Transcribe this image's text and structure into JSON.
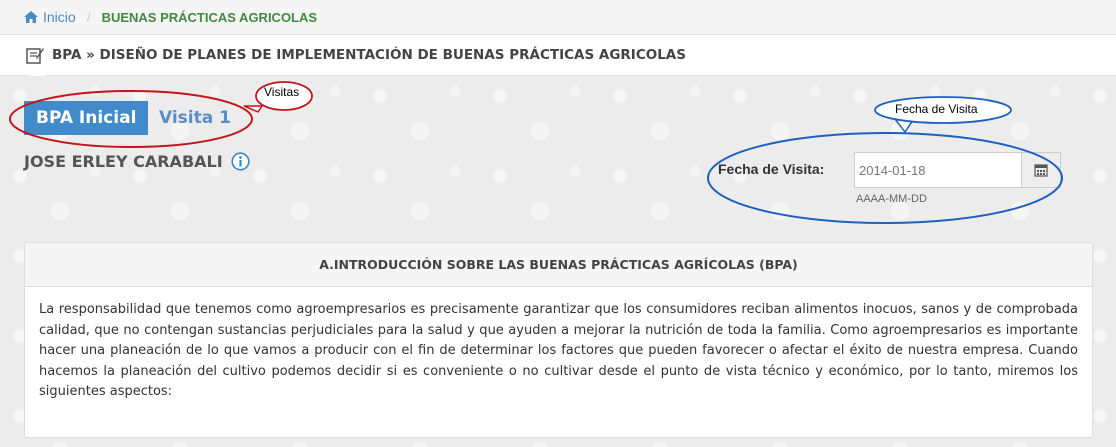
{
  "breadcrumb": {
    "home_label": "Inicio",
    "separator": "/",
    "current": "BUENAS PRÁCTICAS AGRICOLAS"
  },
  "header": {
    "title": "BPA » DISEÑO DE PLANES DE IMPLEMENTACIÓN DE BUENAS PRÁCTICAS AGRICOLAS"
  },
  "tabs": [
    {
      "label": "BPA Inicial",
      "active": true
    },
    {
      "label": "Visita 1",
      "active": false
    }
  ],
  "producer": {
    "name": "JOSE ERLEY CARABALI"
  },
  "visit_date": {
    "label": "Fecha de Visita:",
    "value": "2014-01-18",
    "hint": "AAAA-MM-DD"
  },
  "section": {
    "title": "A.INTRODUCCIÓN SOBRE LAS BUENAS PRÁCTICAS AGRÍCOLAS (BPA)",
    "body": "La responsabilidad que tenemos como agroempresarios es precisamente garantizar que los consumidores reciban alimentos inocuos, sanos y de comprobada calidad, que no contengan sustancias perjudiciales para la salud y que ayuden a mejorar la nutrición de toda la familia. Como agroempresarios es importante hacer una planeación de lo que vamos a producir con el fin de determinar los factores que pueden favorecer o afectar el éxito de nuestra empresa. Cuando hacemos la planeación del cultivo podemos decidir si es conveniente o no cultivar desde el punto de vista técnico y económico, por lo tanto, miremos los siguientes aspectos:"
  },
  "annotations": {
    "visitas": "Visitas",
    "fecha": "Fecha de Visita"
  },
  "colors": {
    "accent": "#428bca",
    "breadcrumb_current": "#3f8a3f",
    "annotation_red": "#c4151c",
    "annotation_blue": "#1f5fbf"
  }
}
